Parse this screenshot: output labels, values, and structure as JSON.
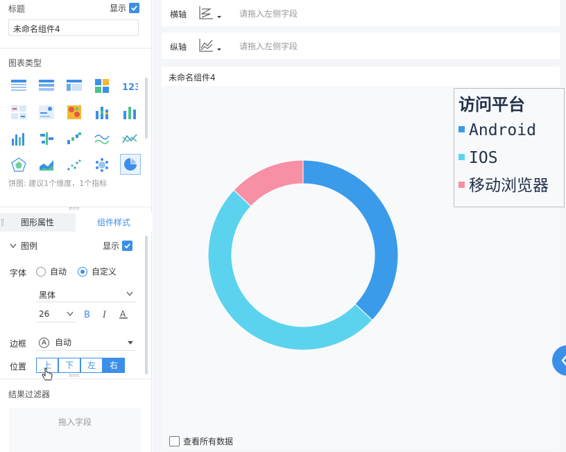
{
  "left": {
    "title_section": {
      "label": "标题",
      "show_label": "显示",
      "title_value": "未命名组件4"
    },
    "chart_type": {
      "label": "图表类型",
      "hint": "饼图: 建议1个维度，1个指标"
    },
    "tabs": [
      "图形属性",
      "组件样式"
    ],
    "legend_section": {
      "label": "图例",
      "show_label": "显示"
    },
    "font": {
      "label": "字体",
      "auto": "自动",
      "custom": "自定义",
      "family": "黑体",
      "size": "26"
    },
    "border": {
      "label": "边框",
      "value": "自动"
    },
    "position": {
      "label": "位置",
      "options": [
        "上",
        "下",
        "左",
        "右"
      ],
      "selected": "右"
    },
    "filter": {
      "label": "结果过滤器",
      "drop_hint": "拖入字段"
    }
  },
  "axes": {
    "x": {
      "label": "横轴",
      "placeholder": "请拖入左侧字段"
    },
    "y": {
      "label": "纵轴",
      "placeholder": "请拖入左侧字段"
    }
  },
  "component": {
    "title": "未命名组件4",
    "view_all": "查看所有数据"
  },
  "chart_data": {
    "type": "pie",
    "title": "访问平台",
    "categories": [
      "Android",
      "IOS",
      "移动浏览器"
    ],
    "values": [
      37,
      50,
      13
    ],
    "colors": [
      "#3a9bea",
      "#5cd3ee",
      "#f78fa5"
    ],
    "donut": true,
    "legend_position": "top-right"
  }
}
